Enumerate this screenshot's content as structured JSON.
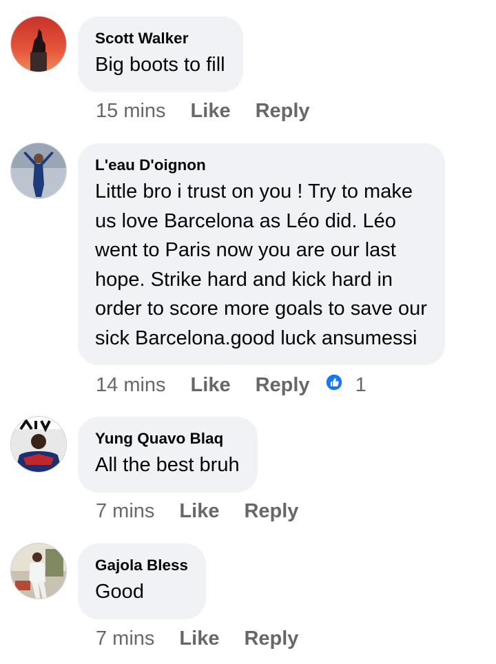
{
  "comments": [
    {
      "author": "Scott Walker",
      "lines": [
        "Big boots to fill"
      ],
      "time": "15 mins",
      "like_label": "Like",
      "reply_label": "Reply"
    },
    {
      "author": "L'eau D'oignon",
      "lines": [
        "Little bro i trust on you !  Try to make",
        "us love Barcelona as Léo did. Léo",
        "went to Paris now you are our last",
        "hope.  Strike hard and kick hard in",
        "order to score more goals to save our",
        "sick Barcelona.good luck ansumessi"
      ],
      "time": "14 mins",
      "like_label": "Like",
      "reply_label": "Reply",
      "reaction_icon": "like-reaction-icon",
      "reaction_count": "1"
    },
    {
      "author": "Yung Quavo Blaq",
      "lines": [
        "All the best bruh"
      ],
      "time": "7 mins",
      "like_label": "Like",
      "reply_label": "Reply"
    },
    {
      "author": "Gajola Bless",
      "lines": [
        "Good"
      ],
      "time": "7 mins",
      "like_label": "Like",
      "reply_label": "Reply"
    }
  ],
  "colors": {
    "bubble": "#f0f2f5",
    "text": "#050505",
    "meta": "#65676b",
    "like_blue": "#1877f2"
  }
}
